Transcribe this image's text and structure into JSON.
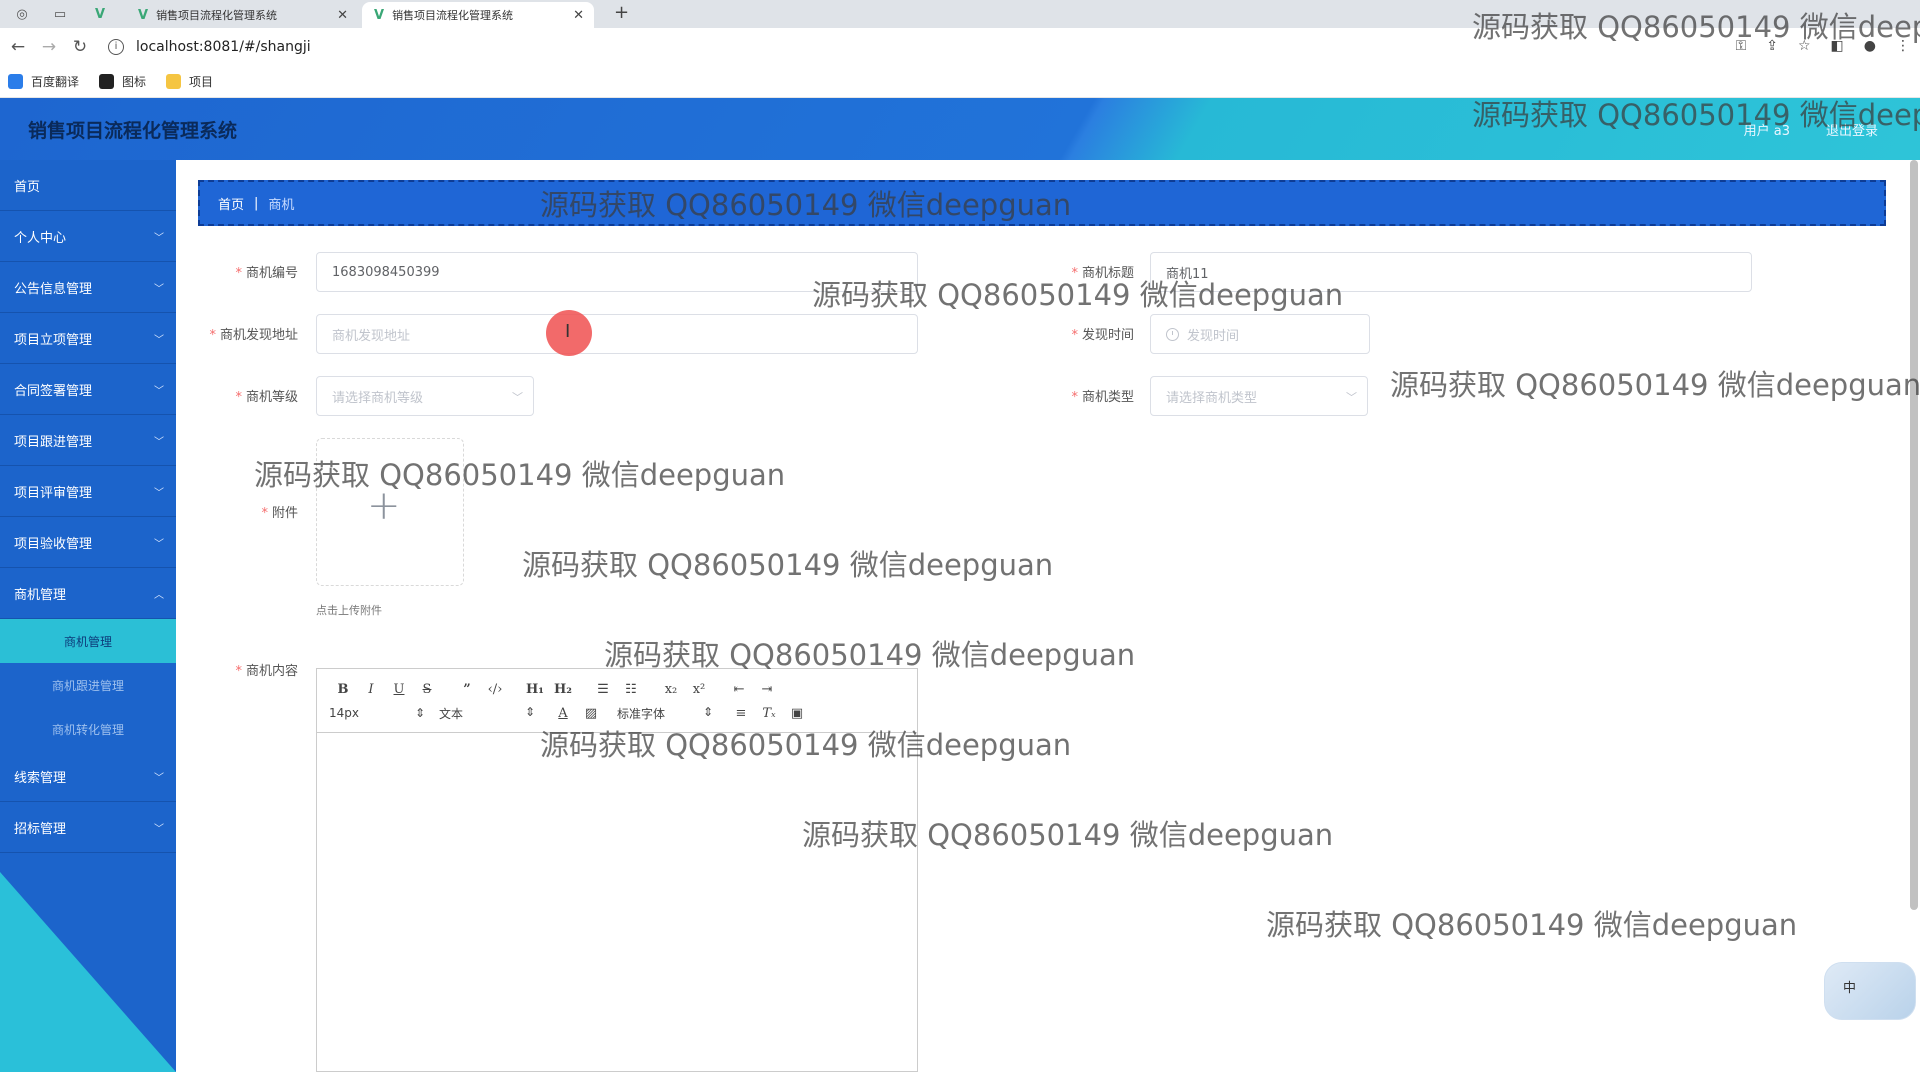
{
  "browser": {
    "tabs": [
      {
        "title": "销售项目流程化管理系统",
        "close": "✕"
      },
      {
        "title": "销售项目流程化管理系统",
        "close": "✕"
      }
    ],
    "new_tab": "+",
    "url": "localhost:8081/#/shangji",
    "bookmarks": [
      "百度翻译",
      "图标",
      "项目"
    ]
  },
  "header": {
    "title": "销售项目流程化管理系统",
    "user": "用户 a3",
    "logout": "退出登录"
  },
  "sidebar": {
    "items": [
      {
        "label": "首页"
      },
      {
        "label": "个人中心"
      },
      {
        "label": "公告信息管理"
      },
      {
        "label": "项目立项管理"
      },
      {
        "label": "合同签署管理"
      },
      {
        "label": "项目跟进管理"
      },
      {
        "label": "项目评审管理"
      },
      {
        "label": "项目验收管理"
      },
      {
        "label": "商机管理"
      },
      {
        "label": "线索管理"
      },
      {
        "label": "招标管理"
      }
    ],
    "submenu": [
      "商机管理",
      "商机跟进管理",
      "商机转化管理"
    ]
  },
  "breadcrumb": {
    "home": "首页",
    "current": "商机"
  },
  "form": {
    "code": {
      "label": "商机编号",
      "value": "1683098450399"
    },
    "title": {
      "label": "商机标题",
      "value": "商机11"
    },
    "address": {
      "label": "商机发现地址",
      "placeholder": "商机发现地址"
    },
    "time": {
      "label": "发现时间",
      "placeholder": "发现时间"
    },
    "level": {
      "label": "商机等级",
      "placeholder": "请选择商机等级"
    },
    "type": {
      "label": "商机类型",
      "placeholder": "请选择商机类型"
    },
    "attachment": {
      "label": "附件",
      "tip": "点击上传附件"
    },
    "content": {
      "label": "商机内容"
    }
  },
  "editor_toolbar": {
    "size": "14px",
    "header": "文本",
    "font": "标准字体"
  },
  "ime": "中",
  "watermark": "源码获取 QQ86050149 微信deepguan",
  "colors": {
    "primary": "#1c64cb",
    "accent": "#2bbfd6",
    "required": "#f56c6c"
  }
}
